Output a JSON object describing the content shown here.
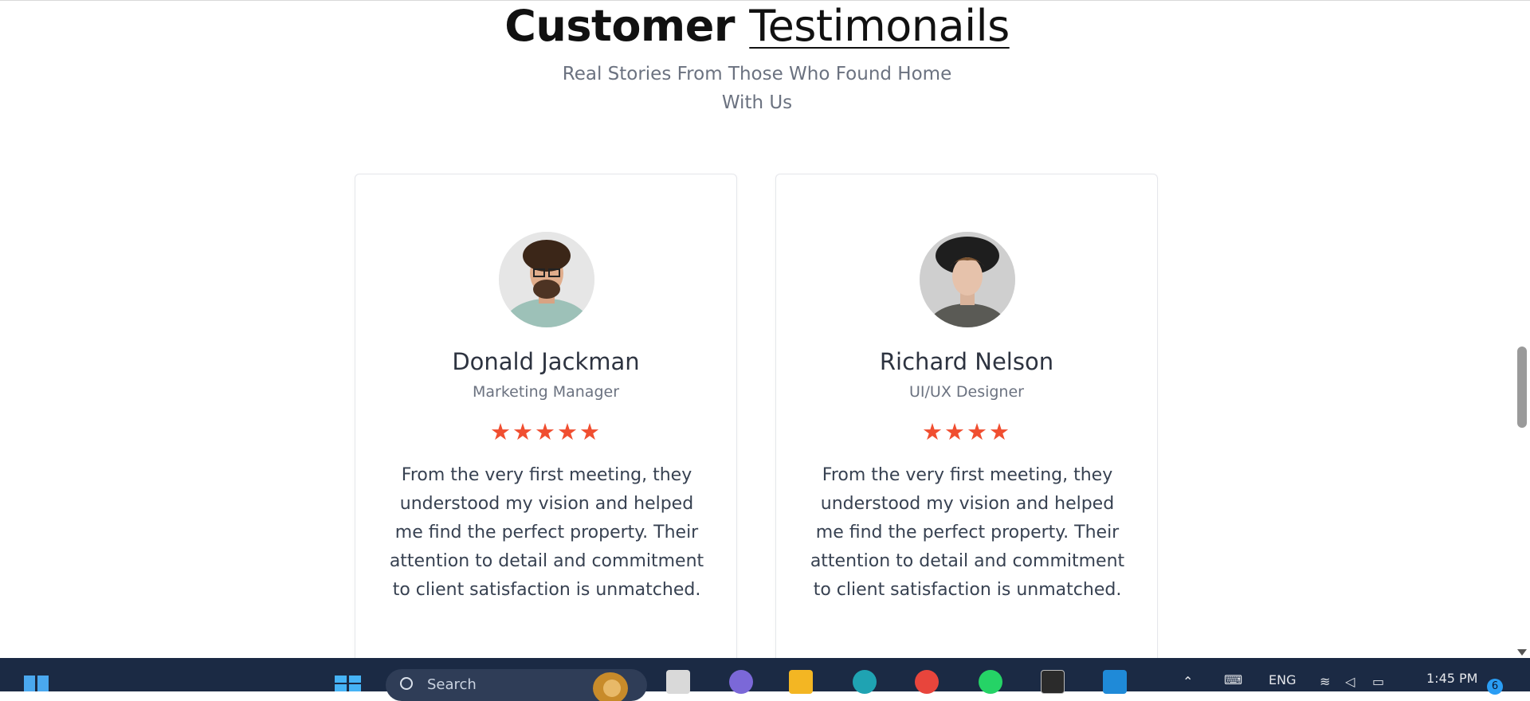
{
  "section": {
    "title_bold": "Customer",
    "title_light": "Testimonails",
    "subtitle_line1": "Real Stories From Those Who Found Home",
    "subtitle_line2": "With Us"
  },
  "testimonials": [
    {
      "name": "Donald Jackman",
      "role": "Marketing Manager",
      "rating": 5,
      "stars": "★★★★★",
      "quote": "From the very first meeting, they understood my vision and helped me find the perfect property. Their attention to detail and commitment to client satisfaction is unmatched."
    },
    {
      "name": "Richard Nelson",
      "role": "UI/UX Designer",
      "rating": 4,
      "stars": "★★★★",
      "quote": "From the very first meeting, they understood my vision and helped me find the perfect property. Their attention to detail and commitment to client satisfaction is unmatched."
    }
  ],
  "taskbar": {
    "search_label": "Search",
    "language": "ENG",
    "time": "1:45 PM",
    "notification_count": "6"
  },
  "colors": {
    "star": "#f04e30",
    "taskbar": "#1b2a44",
    "text_muted": "#6b7280"
  },
  "icons": [
    "start-icon",
    "windows-logo-icon",
    "search-icon",
    "task-view-icon",
    "teams-icon",
    "file-explorer-icon",
    "edge-icon",
    "chrome-icon",
    "whatsapp-icon",
    "terminal-icon",
    "vscode-icon",
    "chevron-up-icon",
    "keyboard-icon",
    "wifi-icon",
    "volume-icon",
    "battery-icon"
  ]
}
